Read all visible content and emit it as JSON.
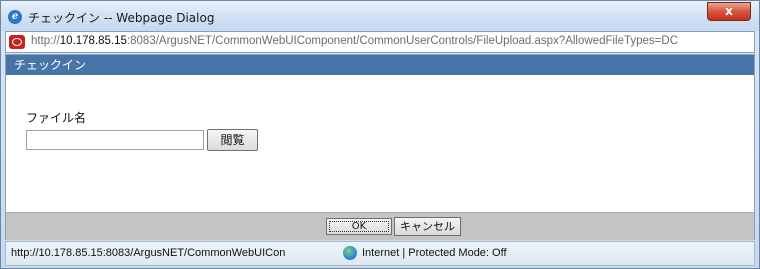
{
  "window": {
    "title": "チェックイン -- Webpage Dialog",
    "close_label": "x"
  },
  "address": {
    "url_prefix": "http://",
    "url_host": "10.178.85.15",
    "url_rest": ":8083/ArgusNET/CommonWebUIComponent/CommonUserControls/FileUpload.aspx?AllowedFileTypes=DC"
  },
  "panel": {
    "header": "チェックイン",
    "file_label": "ファイル名",
    "file_input_value": "",
    "browse_label": "閲覧"
  },
  "footer": {
    "ok_label": "OK",
    "cancel_label": "キャンセル"
  },
  "status": {
    "url": "http://10.178.85.15:8083/ArgusNET/CommonWebUICon",
    "zone": "Internet | Protected Mode: Off"
  }
}
